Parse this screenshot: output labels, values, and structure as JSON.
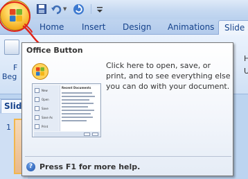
{
  "ribbon": {
    "tabs": [
      {
        "label": "Home"
      },
      {
        "label": "Insert"
      },
      {
        "label": "Design"
      },
      {
        "label": "Animations"
      },
      {
        "label": "Slide S"
      }
    ],
    "left_fragment_1": "F",
    "left_fragment_2": "Beg",
    "right_fragment_1": "H",
    "right_fragment_2": "U"
  },
  "left_pane": {
    "tab_label": "Slide",
    "slide_number": "1"
  },
  "tooltip": {
    "title": "Office Button",
    "description": "Click here to open, save, or print, and to see everything else you can do with your document.",
    "help_text": "Press F1 for more help.",
    "help_icon": "question-icon"
  },
  "preview_menu": {
    "items": [
      "New",
      "Open",
      "Save",
      "Save As",
      "Print"
    ],
    "recent_title": "Recent Documents"
  },
  "colors": {
    "annotation": "#e0241b",
    "tab_text": "#15428b",
    "ribbon_bg": "#dbe8f8"
  },
  "icons": {
    "office_button": "office-logo-icon",
    "save": "save-icon",
    "undo": "undo-icon",
    "redo": "redo-icon",
    "customize": "customize-qat-icon"
  }
}
